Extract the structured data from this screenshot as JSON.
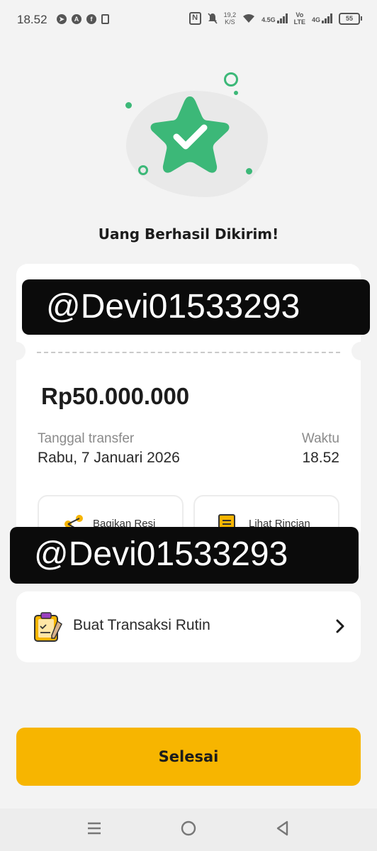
{
  "status_bar": {
    "time": "18.52",
    "speed_value": "19,2",
    "speed_unit": "K/S",
    "net_1": "4.5G",
    "net_2a": "Vo",
    "net_2b": "LTE",
    "net_3": "4G",
    "battery": "55"
  },
  "title": "Uang Berhasil Dikirim!",
  "watermark_1": "@Devi01533293",
  "watermark_2": "@Devi01533293",
  "amount": "Rp50.000.000",
  "date_label": "Tanggal transfer",
  "date_value": "Rabu, 7 Januari 2026",
  "time_label": "Waktu",
  "time_value": "18.52",
  "actions": {
    "share_label": "Bagikan Resi",
    "details_label": "Lihat Rincian"
  },
  "routine_label": "Buat Transaksi Rutin",
  "done_label": "Selesai",
  "colors": {
    "accent": "#f7b500",
    "success": "#3cb878"
  }
}
